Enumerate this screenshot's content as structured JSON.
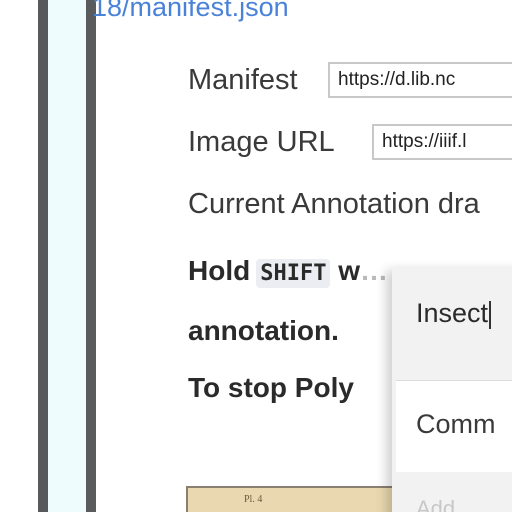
{
  "sidebar": {},
  "manifest_link": "18/manifest.json",
  "manifest_field": {
    "label": "Manifest",
    "value": "https://d.lib.nc"
  },
  "image_url_field": {
    "label": "Image URL",
    "value": "https://iiif.l"
  },
  "current_annotation": "Current Annotation dra",
  "instructions": {
    "hold_prefix": "Hold",
    "shift_key": "SHIFT",
    "hold_suffix": "w",
    "hold_faded": "…",
    "annotation_line": "annotation.",
    "stop_line": "To stop Poly"
  },
  "annotation_editor": {
    "tag_input_value": "Insect",
    "comment_placeholder": "Comm",
    "tags_placeholder": "Add"
  },
  "thumbnail": {
    "label": "Pl. 4"
  }
}
